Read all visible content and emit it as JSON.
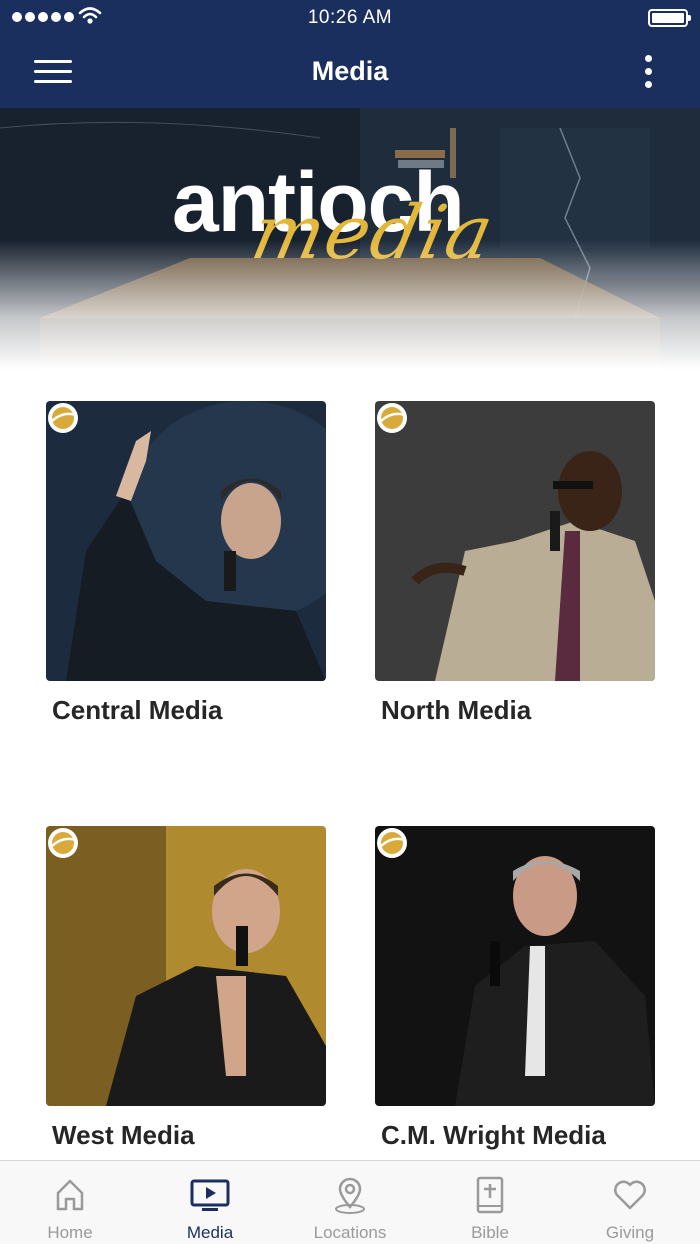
{
  "status_bar": {
    "time": "10:26 AM"
  },
  "nav": {
    "title": "Media",
    "menu_icon": "hamburger-menu-icon",
    "more_icon": "vertical-ellipsis-icon"
  },
  "banner": {
    "word": "antioch",
    "script": "media"
  },
  "media_items": [
    {
      "label": "Central Media",
      "backdrop": "#1d2b3f"
    },
    {
      "label": "North Media",
      "backdrop": "#3c3c3c"
    },
    {
      "label": "West Media",
      "backdrop": "#b08a2e"
    },
    {
      "label": "C.M. Wright Media",
      "backdrop": "#121212"
    }
  ],
  "tabs": [
    {
      "label": "Home",
      "icon": "home-icon",
      "active": false
    },
    {
      "label": "Media",
      "icon": "tv-play-icon",
      "active": true
    },
    {
      "label": "Locations",
      "icon": "location-pin-icon",
      "active": false
    },
    {
      "label": "Bible",
      "icon": "bible-icon",
      "active": false
    },
    {
      "label": "Giving",
      "icon": "heart-icon",
      "active": false
    }
  ],
  "colors": {
    "brand_navy": "#1b2f5e",
    "accent_gold": "#e3b73b",
    "tab_inactive": "#9a9a9a"
  }
}
